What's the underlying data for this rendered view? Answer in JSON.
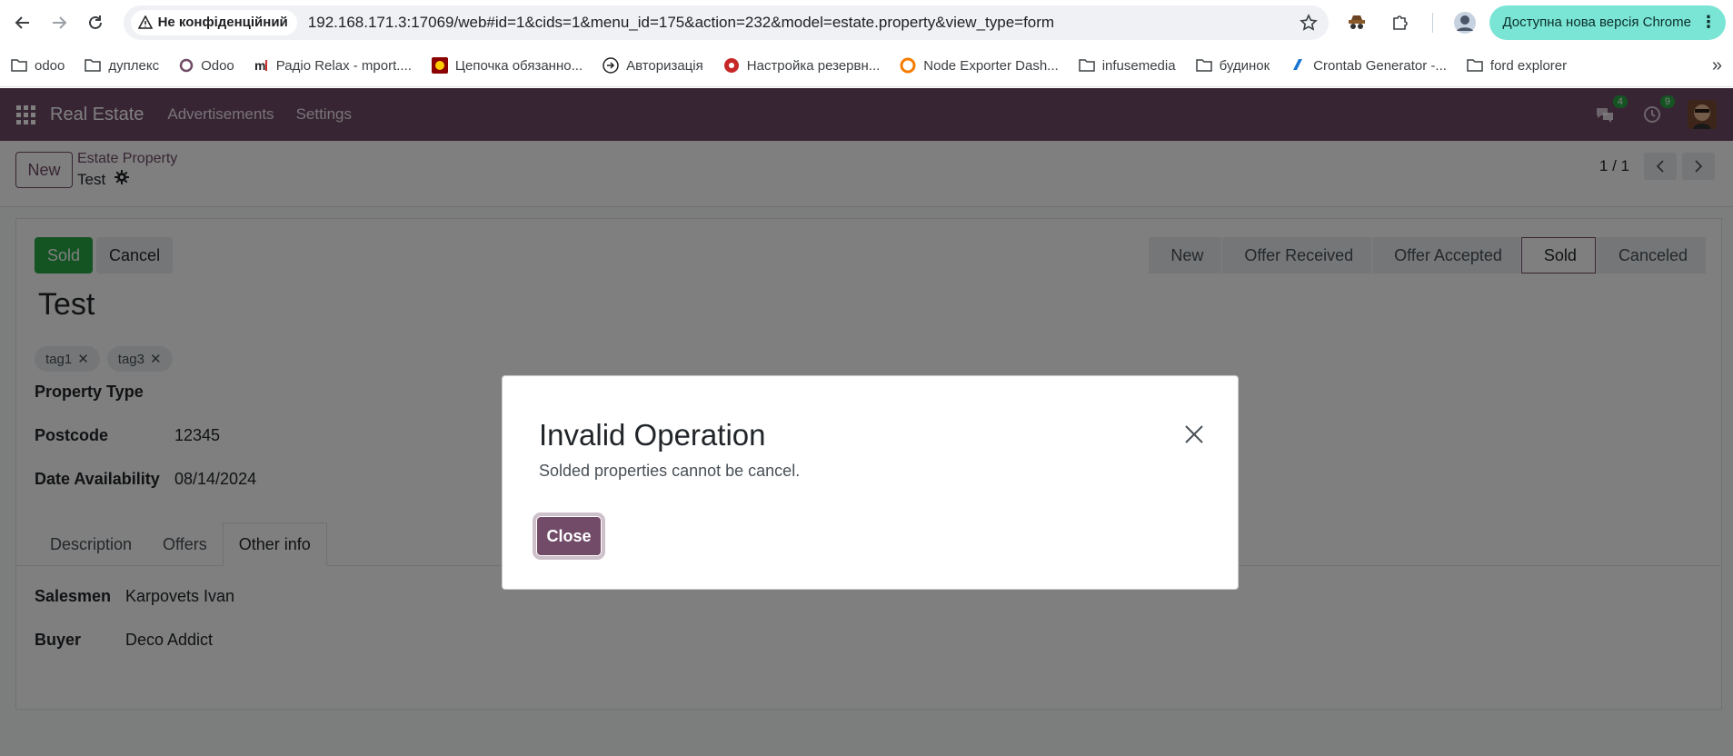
{
  "browser": {
    "not_secure_label": "Не конфіденційний",
    "url": "192.168.171.3:17069/web#id=1&cids=1&menu_id=175&action=232&model=estate.property&view_type=form",
    "update_label": "Доступна нова версія Chrome",
    "bookmarks": [
      {
        "label": "odoo",
        "icon": "folder-icon"
      },
      {
        "label": "дуплекс",
        "icon": "folder-icon"
      },
      {
        "label": "Odoo",
        "icon": "odoo-icon"
      },
      {
        "label": "Радіо Relax - mport....",
        "icon": "radio-icon"
      },
      {
        "label": "Цепочка обязанно...",
        "icon": "site-icon"
      },
      {
        "label": "Авторизація",
        "icon": "login-icon"
      },
      {
        "label": "Настройка резервн...",
        "icon": "backup-icon"
      },
      {
        "label": "Node Exporter Dash...",
        "icon": "grafana-icon"
      },
      {
        "label": "infusemedia",
        "icon": "folder-icon"
      },
      {
        "label": "будинок",
        "icon": "folder-icon"
      },
      {
        "label": "Crontab Generator -...",
        "icon": "crontab-icon"
      },
      {
        "label": "ford explorer",
        "icon": "folder-icon"
      }
    ]
  },
  "navbar": {
    "brand": "Real Estate",
    "menu": [
      "Advertisements",
      "Settings"
    ],
    "messages_count": "4",
    "activities_count": "9"
  },
  "control_panel": {
    "new_label": "New",
    "breadcrumb": "Estate Property",
    "record_name": "Test",
    "pager": "1 / 1"
  },
  "form": {
    "buttons": {
      "sold": "Sold",
      "cancel": "Cancel"
    },
    "stages": [
      "New",
      "Offer Received",
      "Offer Accepted",
      "Sold",
      "Canceled"
    ],
    "active_stage": "Sold",
    "title": "Test",
    "tags": [
      "tag1",
      "tag3"
    ],
    "fields": {
      "property_type_label": "Property Type",
      "postcode_label": "Postcode",
      "postcode_value": "12345",
      "date_label": "Date Availability",
      "date_value": "08/14/2024"
    },
    "tabs": [
      "Description",
      "Offers",
      "Other info"
    ],
    "active_tab": "Other info",
    "other_info": {
      "salesmen_label": "Salesmen",
      "salesmen_value": "Karpovets Ivan",
      "buyer_label": "Buyer",
      "buyer_value": "Deco Addict"
    }
  },
  "dialog": {
    "title": "Invalid Operation",
    "message": "Solded properties cannot be cancel.",
    "close_label": "Close"
  }
}
